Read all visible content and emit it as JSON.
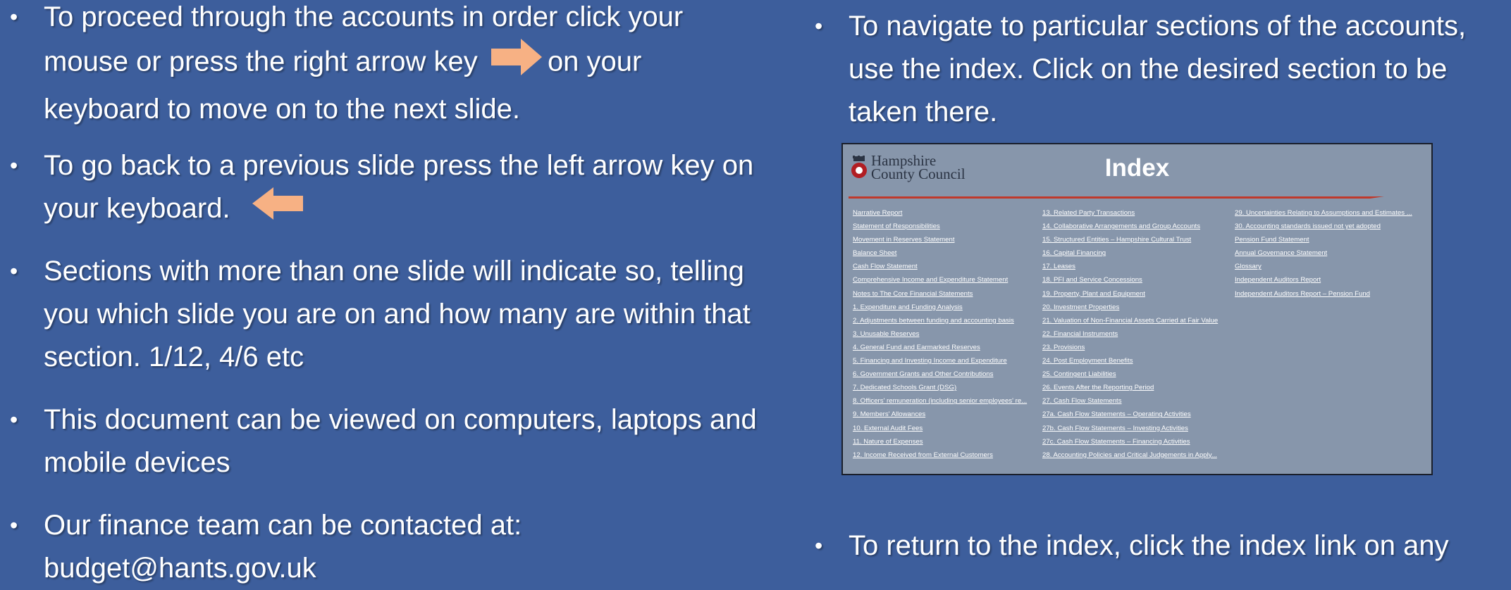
{
  "left_bullets": [
    {
      "before": "To proceed through the accounts in order click your mouse or press the right arrow key",
      "after": "on your keyboard to move on to the next slide."
    },
    {
      "text": "To go back to a previous slide press the left arrow key on your keyboard."
    },
    {
      "text": "Sections with more than one slide will indicate so, telling you which slide you are on and how many are within that section. 1/12, 4/6 etc"
    },
    {
      "text": "This document can be viewed on computers, laptops and mobile devices"
    },
    {
      "text": "Our finance team can be contacted at: budget@hants.gov.uk"
    }
  ],
  "right_bullets": [
    {
      "text": "To navigate to particular sections of the accounts, use the index. Click on the desired section to be taken there."
    },
    {
      "text": "To return to the index, click the index link on any"
    }
  ],
  "icons": {
    "right_arrow": "right-arrow-icon",
    "left_arrow": "left-arrow-icon",
    "crest": "crest-icon"
  },
  "colors": {
    "background": "#3d5e9c",
    "arrow": "#f7b184",
    "thumb_bg": "#8796ab",
    "thumb_rule": "#c0392b"
  },
  "index_preview": {
    "logo_line1": "Hampshire",
    "logo_line2": "County Council",
    "title": "Index",
    "col1": [
      "Narrative Report",
      "Statement of Responsibilities",
      "Movement in Reserves Statement",
      "Balance Sheet",
      "Cash Flow Statement",
      "Comprehensive Income and Expenditure Statement",
      "Notes to The Core Financial Statements",
      "1. Expenditure and Funding Analysis",
      "2. Adjustments between funding and accounting basis",
      "3. Unusable Reserves",
      "4. General Fund and Earmarked Reserves",
      "5. Financing and Investing Income and Expenditure",
      "6. Government Grants and Other Contributions",
      "7. Dedicated Schools Grant (DSG)",
      "8. Officers' remuneration (including senior employees' re...",
      "9. Members' Allowances",
      "10. External Audit Fees",
      "11. Nature of Expenses",
      "12. Income Received from External Customers"
    ],
    "col2": [
      "13. Related Party Transactions",
      "14. Collaborative Arrangements and Group Accounts",
      "15. Structured Entities – Hampshire Cultural Trust",
      "16. Capital Financing",
      "17. Leases",
      "18. PFI and Service Concessions",
      "19. Property, Plant and Equipment",
      "20. Investment Properties",
      "21. Valuation of Non-Financial Assets Carried at Fair Value",
      "22. Financial Instruments",
      "23. Provisions",
      "24. Post Employment Benefits",
      "25. Contingent Liabilities",
      "26. Events After the Reporting Period",
      "27. Cash Flow Statements",
      "27a. Cash Flow Statements – Operating Activities",
      "27b. Cash Flow Statements – Investing Activities",
      "27c. Cash Flow Statements – Financing Activities",
      "28. Accounting Policies and Critical Judgements in Apply..."
    ],
    "col3": [
      "29. Uncertainties Relating to Assumptions and Estimates ...",
      "30. Accounting standards issued not yet adopted",
      "Pension Fund Statement",
      "Annual Governance Statement",
      "Glossary",
      "Independent Auditors Report",
      "Independent Auditors Report – Pension Fund"
    ]
  }
}
